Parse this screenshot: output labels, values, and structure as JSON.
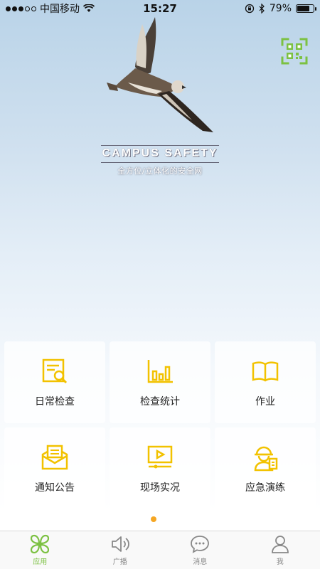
{
  "status_bar": {
    "carrier": "中国移动",
    "time": "15:27",
    "battery_percent": "79%",
    "battery_level": 0.79
  },
  "hero": {
    "title": "CAMPUS SAFETY",
    "subtitle": "全方位/立体化的安全网"
  },
  "grid": {
    "items": [
      {
        "label": "日常检查",
        "icon": "daily-check-icon"
      },
      {
        "label": "检查统计",
        "icon": "bar-chart-icon"
      },
      {
        "label": "作业",
        "icon": "book-icon"
      },
      {
        "label": "通知公告",
        "icon": "mail-icon"
      },
      {
        "label": "现场实况",
        "icon": "video-icon"
      },
      {
        "label": "应急演练",
        "icon": "worker-icon"
      }
    ]
  },
  "tabs": [
    {
      "label": "应用",
      "icon": "apps-icon",
      "active": true
    },
    {
      "label": "广播",
      "icon": "speaker-icon",
      "active": false
    },
    {
      "label": "消息",
      "icon": "chat-icon",
      "active": false
    },
    {
      "label": "我",
      "icon": "person-icon",
      "active": false
    }
  ],
  "colors": {
    "accent_yellow": "#f2c200",
    "accent_green": "#7cc142",
    "page_dot": "#f5a623"
  }
}
